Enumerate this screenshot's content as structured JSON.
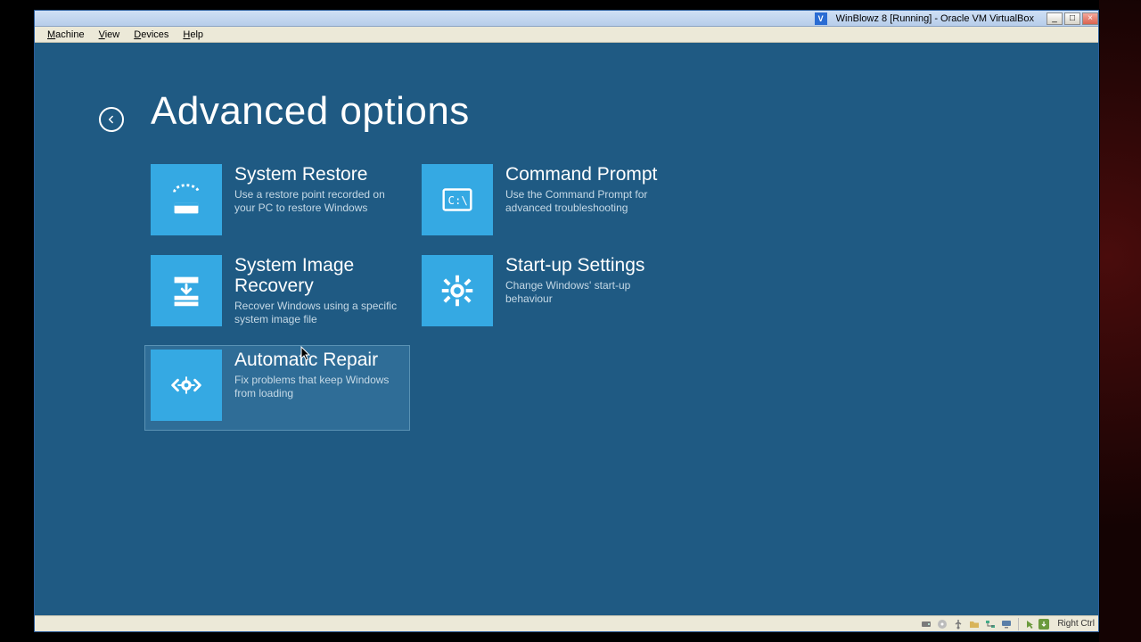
{
  "titlebar": {
    "title": "WinBlowz 8 [Running] - Oracle VM VirtualBox"
  },
  "menubar": {
    "items": [
      {
        "label": "Machine",
        "accel": "M"
      },
      {
        "label": "View",
        "accel": "V"
      },
      {
        "label": "Devices",
        "accel": "D"
      },
      {
        "label": "Help",
        "accel": "H"
      }
    ]
  },
  "page": {
    "title": "Advanced options"
  },
  "tiles": [
    {
      "id": "system-restore",
      "title": "System Restore",
      "desc": "Use a restore point recorded on your PC to restore Windows",
      "icon": "restore-icon"
    },
    {
      "id": "command-prompt",
      "title": "Command Prompt",
      "desc": "Use the Command Prompt for advanced troubleshooting",
      "icon": "cmd-icon"
    },
    {
      "id": "system-image-recovery",
      "title": "System Image Recovery",
      "desc": "Recover Windows using a specific system image file",
      "icon": "image-recovery-icon"
    },
    {
      "id": "startup-settings",
      "title": "Start-up Settings",
      "desc": "Change Windows' start-up behaviour",
      "icon": "gear-icon"
    },
    {
      "id": "automatic-repair",
      "title": "Automatic Repair",
      "desc": "Fix problems that keep Windows from loading",
      "icon": "repair-icon",
      "hovered": true
    }
  ],
  "statusbar": {
    "hostkey": "Right Ctrl",
    "icons": [
      "hdd-icon",
      "disc-icon",
      "usb-icon",
      "folder-icon",
      "net-icon",
      "display-icon",
      "mouse-capture-icon"
    ]
  }
}
